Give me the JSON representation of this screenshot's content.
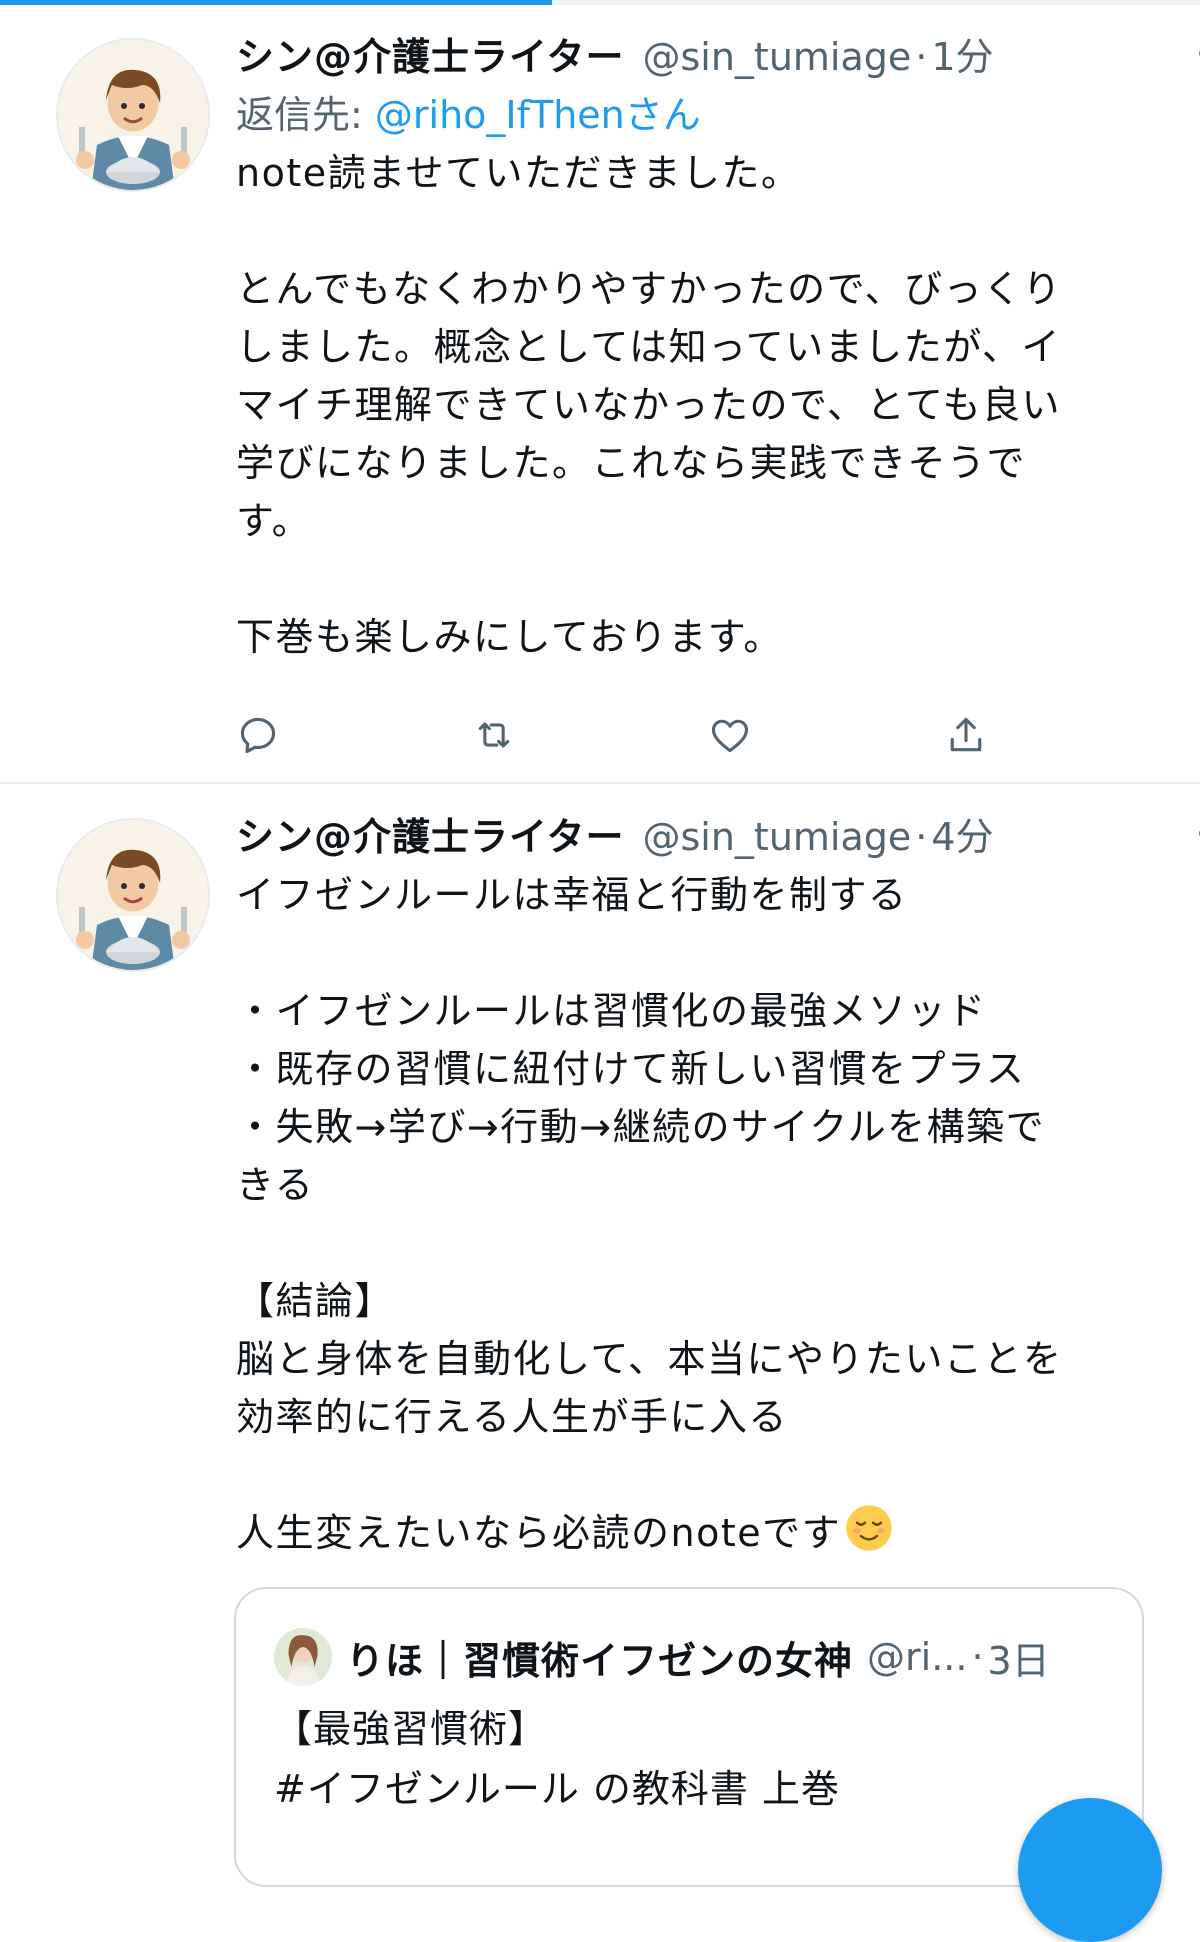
{
  "progress": {
    "fraction": 0.46,
    "color": "#1d9bf0"
  },
  "tweets": [
    {
      "name": "シン@介護士ライター",
      "handle": "@sin_tumiage",
      "separator": "·",
      "time": "1分",
      "more_label": "···",
      "reply_prefix": "返信先: ",
      "reply_to": "@riho_IfThenさん",
      "text": "note読ませていただきました。\n\nとんでもなくわかりやすかったので、びっくり\nしました。概念としては知っていましたが、イ\nマイチ理解できていなかったので、とても良い\n学びになりました。これなら実践できそうで\nす。\n\n下巻も楽しみにしております。",
      "actions": [
        "reply-icon",
        "retweet-icon",
        "like-icon",
        "share-icon"
      ]
    },
    {
      "name": "シン@介護士ライター",
      "handle": "@sin_tumiage",
      "separator": "·",
      "time": "4分",
      "more_label": "···",
      "text": "イフゼンルールは幸福と行動を制する\n\n・イフゼンルールは習慣化の最強メソッド\n・既存の習慣に紐付けて新しい習慣をプラス\n・失敗→学び→行動→継続のサイクルを構築で\nきる\n\n【結論】\n脳と身体を自動化して、本当にやりたいことを\n効率的に行える人生が手に入る\n\n人生変えたいなら必読のnoteです",
      "emoji": "relieved-face",
      "quote": {
        "name": "りほ｜習慣術イフゼンの女神",
        "handle": "@ri...",
        "separator": "·",
        "time": "3日",
        "text": "【最強習慣術】\n#イフゼンルール の教科書 上巻"
      }
    }
  ],
  "accent_color": "#1d9bf0",
  "secondary_text_color": "#536471"
}
